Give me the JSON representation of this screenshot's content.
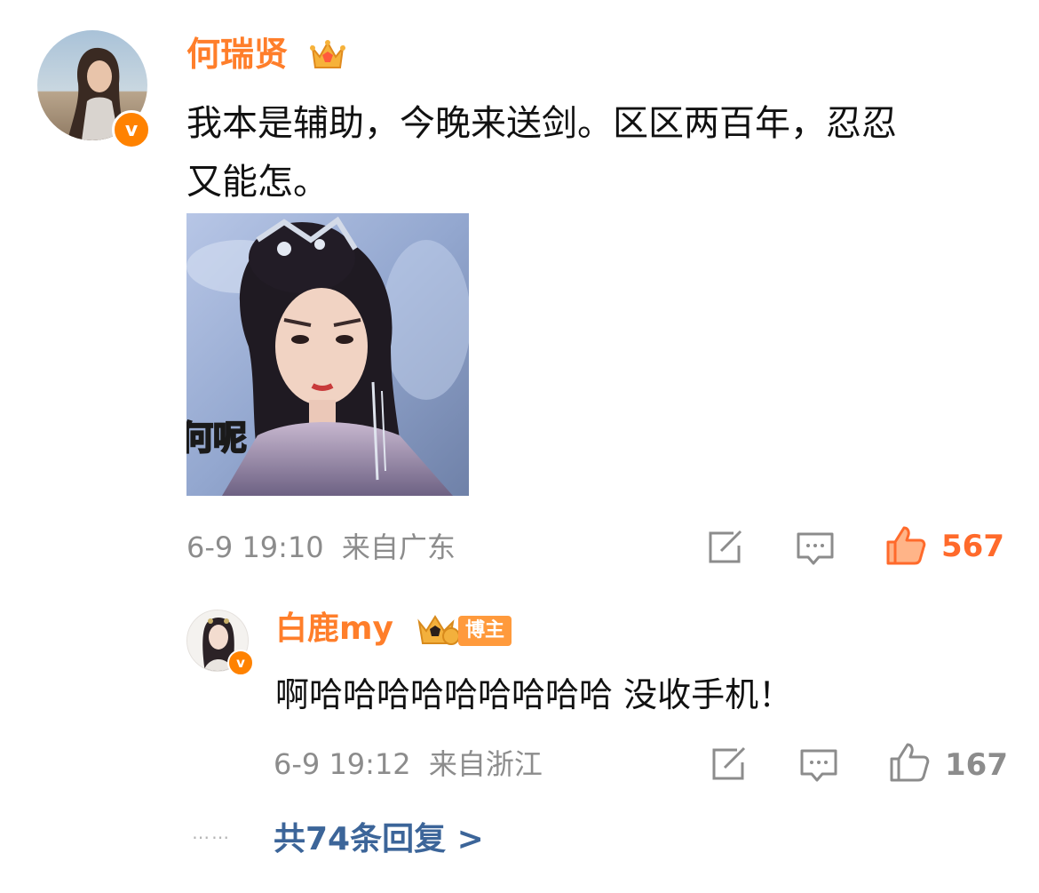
{
  "comment": {
    "username": "何瑞贤",
    "text": "我本是辅助，今晚来送剑。区区两百年，忍忍\n又能怎。",
    "image_caption": "何呢",
    "date": "6-9 19:10",
    "location": "来自广东",
    "like_count": "567",
    "like_color": "#ff6a2b"
  },
  "reply": {
    "username": "白鹿my",
    "badge_label": "博主",
    "text": "啊哈哈哈哈哈哈哈哈哈 没收手机！",
    "date": "6-9 19:12",
    "location": "来自浙江",
    "like_count": "167"
  },
  "more_replies": {
    "label": "共74条回复 >"
  },
  "colors": {
    "username": "#ff7e2a",
    "verified_badge": "#ff8200",
    "link": "#3c6599",
    "meta": "#8c8c8c"
  },
  "icons": {
    "repost": "repost-icon",
    "comment": "comment-icon",
    "like": "thumbs-up-icon",
    "crown": "crown-icon",
    "verified": "verified-v-icon"
  }
}
